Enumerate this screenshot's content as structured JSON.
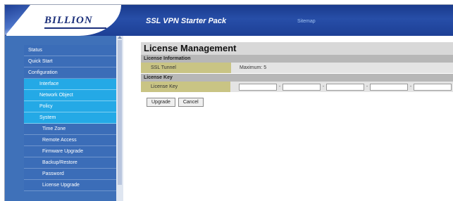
{
  "header": {
    "logo": "BILLION",
    "product_title": "SSL VPN Starter Pack",
    "sitemap_label": "Sitemap"
  },
  "sidebar": {
    "items": [
      {
        "label": "Status",
        "level": "top"
      },
      {
        "label": "Quick Start",
        "level": "top"
      },
      {
        "label": "Configuration",
        "level": "top"
      },
      {
        "label": "Interface",
        "level": "sub"
      },
      {
        "label": "Network Object",
        "level": "sub"
      },
      {
        "label": "Policy",
        "level": "sub"
      },
      {
        "label": "System",
        "level": "sub"
      },
      {
        "label": "Time Zone",
        "level": "subsub"
      },
      {
        "label": "Remote Access",
        "level": "subsub"
      },
      {
        "label": "Firmware Upgrade",
        "level": "subsub"
      },
      {
        "label": "Backup/Restore",
        "level": "subsub"
      },
      {
        "label": "Password",
        "level": "subsub"
      },
      {
        "label": "License Upgrade",
        "level": "subsub"
      }
    ]
  },
  "main": {
    "title": "License Management",
    "license_info": {
      "heading": "License Information",
      "label": "SSL Tunnel",
      "value": "Maximum: 5"
    },
    "license_key": {
      "heading": "License Key",
      "label": "License Key",
      "field_count": 5
    },
    "buttons": {
      "upgrade": "Upgrade",
      "cancel": "Cancel"
    }
  },
  "colors": {
    "header_blue": "#274ea8",
    "sidebar_blue": "#3f71b9",
    "submenu_cyan": "#24a9e6",
    "label_olive": "#c9c484"
  }
}
